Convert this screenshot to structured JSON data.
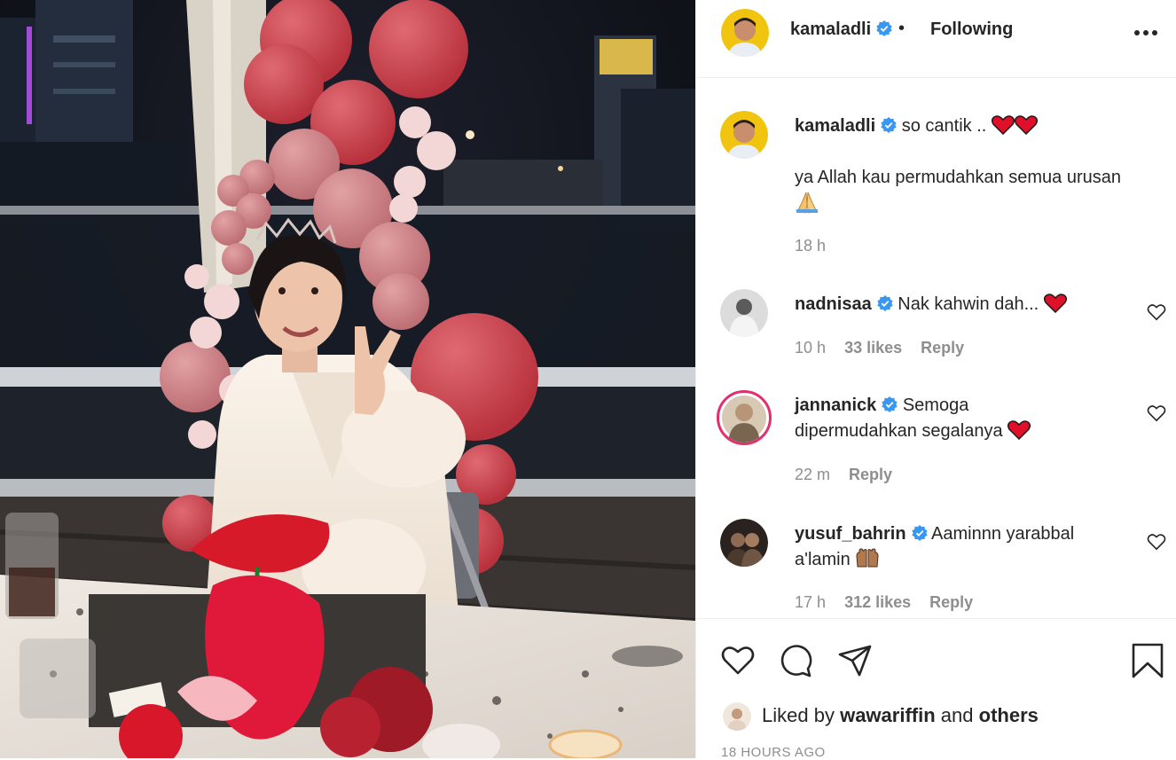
{
  "post": {
    "author": "kamaladli",
    "follow_state": "Following",
    "separator": "•"
  },
  "caption": {
    "username": "kamaladli",
    "line1": "so cantik ..",
    "line2": "ya Allah kau permudahkan semua urusan",
    "time": "18 h"
  },
  "comments": [
    {
      "username": "nadnisaa",
      "text": "Nak kahwin dah...",
      "time": "10 h",
      "likes": "33 likes",
      "reply": "Reply"
    },
    {
      "username": "jannanick",
      "text_part1": "Semoga",
      "text_part2": "dipermudahkan segalanya",
      "time": "22 m",
      "reply": "Reply"
    },
    {
      "username": "yusuf_bahrin",
      "text_part1": "Aaminnn yarabbal",
      "text_part2": "a'lamin",
      "time": "17 h",
      "likes": "312 likes",
      "reply": "Reply"
    }
  ],
  "likes": {
    "prefix": "Liked by",
    "user": "wawariffin",
    "middle": "and",
    "others": "others"
  },
  "timestamp": "18 HOURS AGO",
  "icons": {
    "verified": "verified-badge-icon",
    "more": "more-options-icon",
    "like": "heart-outline-icon",
    "comment": "comment-bubble-icon",
    "share": "paper-plane-icon",
    "save": "bookmark-icon"
  },
  "colors": {
    "verified_blue": "#3897f0",
    "muted_text": "#8e8e8e",
    "heart_red": "#e0245e"
  }
}
